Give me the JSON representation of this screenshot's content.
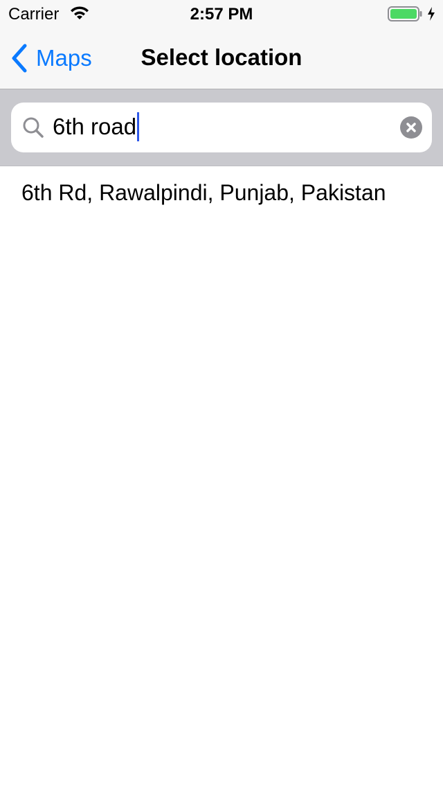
{
  "status_bar": {
    "carrier": "Carrier",
    "time": "2:57 PM",
    "battery_color": "#4cd964"
  },
  "nav": {
    "back_label": "Maps",
    "title": "Select location",
    "accent_color": "#0a7aff"
  },
  "search": {
    "value": "6th road",
    "icon": "search-icon",
    "clear_icon": "clear-icon"
  },
  "results": [
    {
      "label": "6th Rd, Rawalpindi, Punjab, Pakistan"
    }
  ]
}
